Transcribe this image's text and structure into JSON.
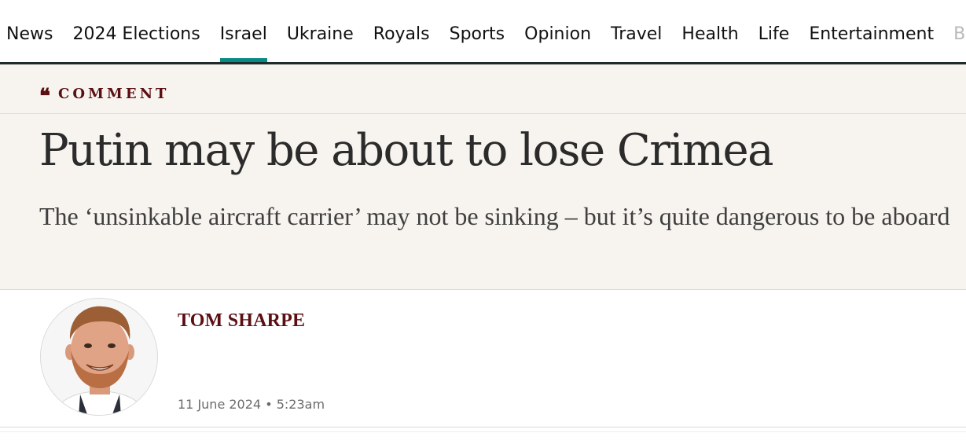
{
  "nav": {
    "items": [
      {
        "label": "News"
      },
      {
        "label": "2024 Elections"
      },
      {
        "label": "Israel"
      },
      {
        "label": "Ukraine"
      },
      {
        "label": "Royals"
      },
      {
        "label": "Sports"
      },
      {
        "label": "Opinion"
      },
      {
        "label": "Travel"
      },
      {
        "label": "Health"
      },
      {
        "label": "Life"
      },
      {
        "label": "Entertainment"
      },
      {
        "label": "Bu"
      }
    ],
    "active_item": "Israel",
    "active_color": "#0a8a85"
  },
  "article": {
    "kicker_icon": "quote-mark-icon",
    "kicker": "COMMENT",
    "headline": "Putin may be about to lose Crimea",
    "standfirst": "The ‘unsinkable aircraft carrier’ may not be sinking – but it’s quite dangerous to be aboard",
    "author": "TOM SHARPE",
    "date": "11 June 2024",
    "separator": "•",
    "time": "5:23am",
    "accent_color": "#5b0f13",
    "band_color": "#f7f4ef"
  },
  "avatar": {
    "icon": "author-portrait-avatar"
  }
}
